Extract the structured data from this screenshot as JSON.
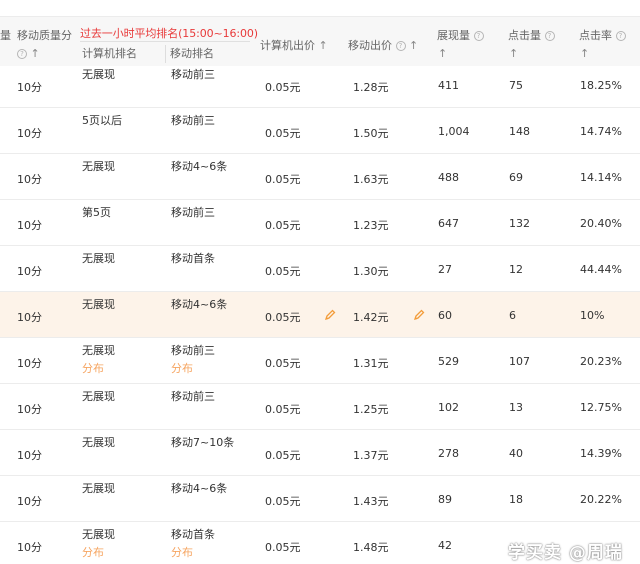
{
  "header": {
    "col_partial": "量",
    "mobile_quality": "移动质量分",
    "avg_rank_title": "过去一小时平均排名(15:00~16:00)",
    "pc_rank": "计算机排名",
    "mobile_rank": "移动排名",
    "pc_bid": "计算机出价",
    "mobile_bid": "移动出价",
    "impressions": "展现量",
    "clicks": "点击量",
    "ctr": "点击率",
    "hint_glyph": "?",
    "sort_glyph": "↑"
  },
  "rows": [
    {
      "quality": "10分",
      "pc_rank": "无展现",
      "mobile_rank": "移动前三",
      "pc_bid": "0.05元",
      "mobile_bid": "1.28元",
      "impressions": "411",
      "clicks": "75",
      "ctr": "18.25%"
    },
    {
      "quality": "10分",
      "pc_rank": "5页以后",
      "mobile_rank": "移动前三",
      "pc_bid": "0.05元",
      "mobile_bid": "1.50元",
      "impressions": "1,004",
      "clicks": "148",
      "ctr": "14.74%"
    },
    {
      "quality": "10分",
      "pc_rank": "无展现",
      "mobile_rank": "移动4~6条",
      "pc_bid": "0.05元",
      "mobile_bid": "1.63元",
      "impressions": "488",
      "clicks": "69",
      "ctr": "14.14%"
    },
    {
      "quality": "10分",
      "pc_rank": "第5页",
      "mobile_rank": "移动前三",
      "pc_bid": "0.05元",
      "mobile_bid": "1.23元",
      "impressions": "647",
      "clicks": "132",
      "ctr": "20.40%"
    },
    {
      "quality": "10分",
      "pc_rank": "无展现",
      "mobile_rank": "移动首条",
      "pc_bid": "0.05元",
      "mobile_bid": "1.30元",
      "impressions": "27",
      "clicks": "12",
      "ctr": "44.44%"
    },
    {
      "quality": "10分",
      "pc_rank": "无展现",
      "mobile_rank": "移动4~6条",
      "pc_bid": "0.05元",
      "mobile_bid": "1.42元",
      "impressions": "60",
      "clicks": "6",
      "ctr": "10%"
    },
    {
      "quality": "10分",
      "pc_rank": "无展现",
      "mobile_rank": "移动前三",
      "pc_bid": "0.05元",
      "mobile_bid": "1.31元",
      "impressions": "529",
      "clicks": "107",
      "ctr": "20.23%",
      "pc_sub": "分布",
      "mobile_sub": "分布"
    },
    {
      "quality": "10分",
      "pc_rank": "无展现",
      "mobile_rank": "移动前三",
      "pc_bid": "0.05元",
      "mobile_bid": "1.25元",
      "impressions": "102",
      "clicks": "13",
      "ctr": "12.75%"
    },
    {
      "quality": "10分",
      "pc_rank": "无展现",
      "mobile_rank": "移动7~10条",
      "pc_bid": "0.05元",
      "mobile_bid": "1.37元",
      "impressions": "278",
      "clicks": "40",
      "ctr": "14.39%"
    },
    {
      "quality": "10分",
      "pc_rank": "无展现",
      "mobile_rank": "移动4~6条",
      "pc_bid": "0.05元",
      "mobile_bid": "1.43元",
      "impressions": "89",
      "clicks": "18",
      "ctr": "20.22%"
    },
    {
      "quality": "10分",
      "pc_rank": "无展现",
      "mobile_rank": "移动首条",
      "pc_bid": "0.05元",
      "mobile_bid": "1.48元",
      "impressions": "42",
      "clicks": "",
      "ctr": "",
      "pc_sub": "分布",
      "mobile_sub": "分布"
    }
  ],
  "watermark": "学买卖 @周瑞",
  "colors": {
    "highlight_row": "#fdf3e9",
    "accent_red": "#e83a3a",
    "sub_link": "#f6a561",
    "pencil": "#f39c3a"
  }
}
